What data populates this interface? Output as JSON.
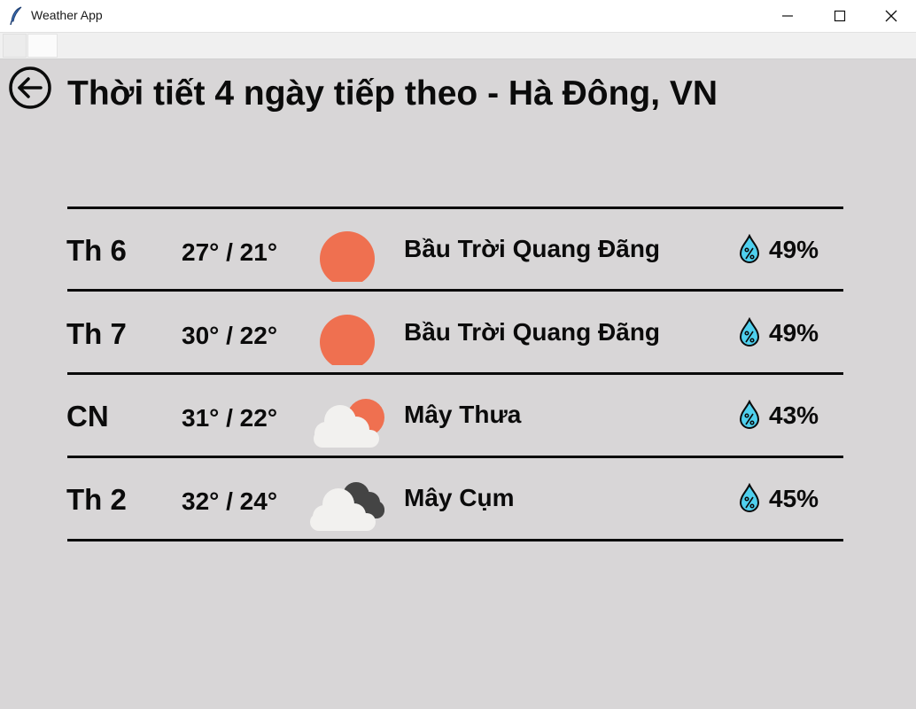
{
  "window": {
    "title": "Weather App",
    "app_icon": "feather-icon"
  },
  "header": {
    "back_icon": "back-arrow-icon",
    "title": "Thời tiết 4 ngày tiếp theo - Hà Đông, VN"
  },
  "forecast": [
    {
      "day": "Th 6",
      "temp": "27° / 21°",
      "icon": "sun-icon",
      "description": "Bầu Trời Quang Đãng",
      "humidity": "49%"
    },
    {
      "day": "Th 7",
      "temp": "30° / 22°",
      "icon": "sun-icon",
      "description": "Bầu Trời Quang Đãng",
      "humidity": "49%"
    },
    {
      "day": "CN",
      "temp": "31° / 22°",
      "icon": "few-clouds-icon",
      "description": "Mây Thưa",
      "humidity": "43%"
    },
    {
      "day": "Th 2",
      "temp": "32° / 24°",
      "icon": "broken-clouds-icon",
      "description": "Mây Cụm",
      "humidity": "45%"
    }
  ],
  "colors": {
    "background": "#d8d6d7",
    "sun": "#ef7050",
    "cloud_light": "#f2f1ef",
    "cloud_dark": "#444444",
    "humidity_drop": "#4fd0ee"
  }
}
